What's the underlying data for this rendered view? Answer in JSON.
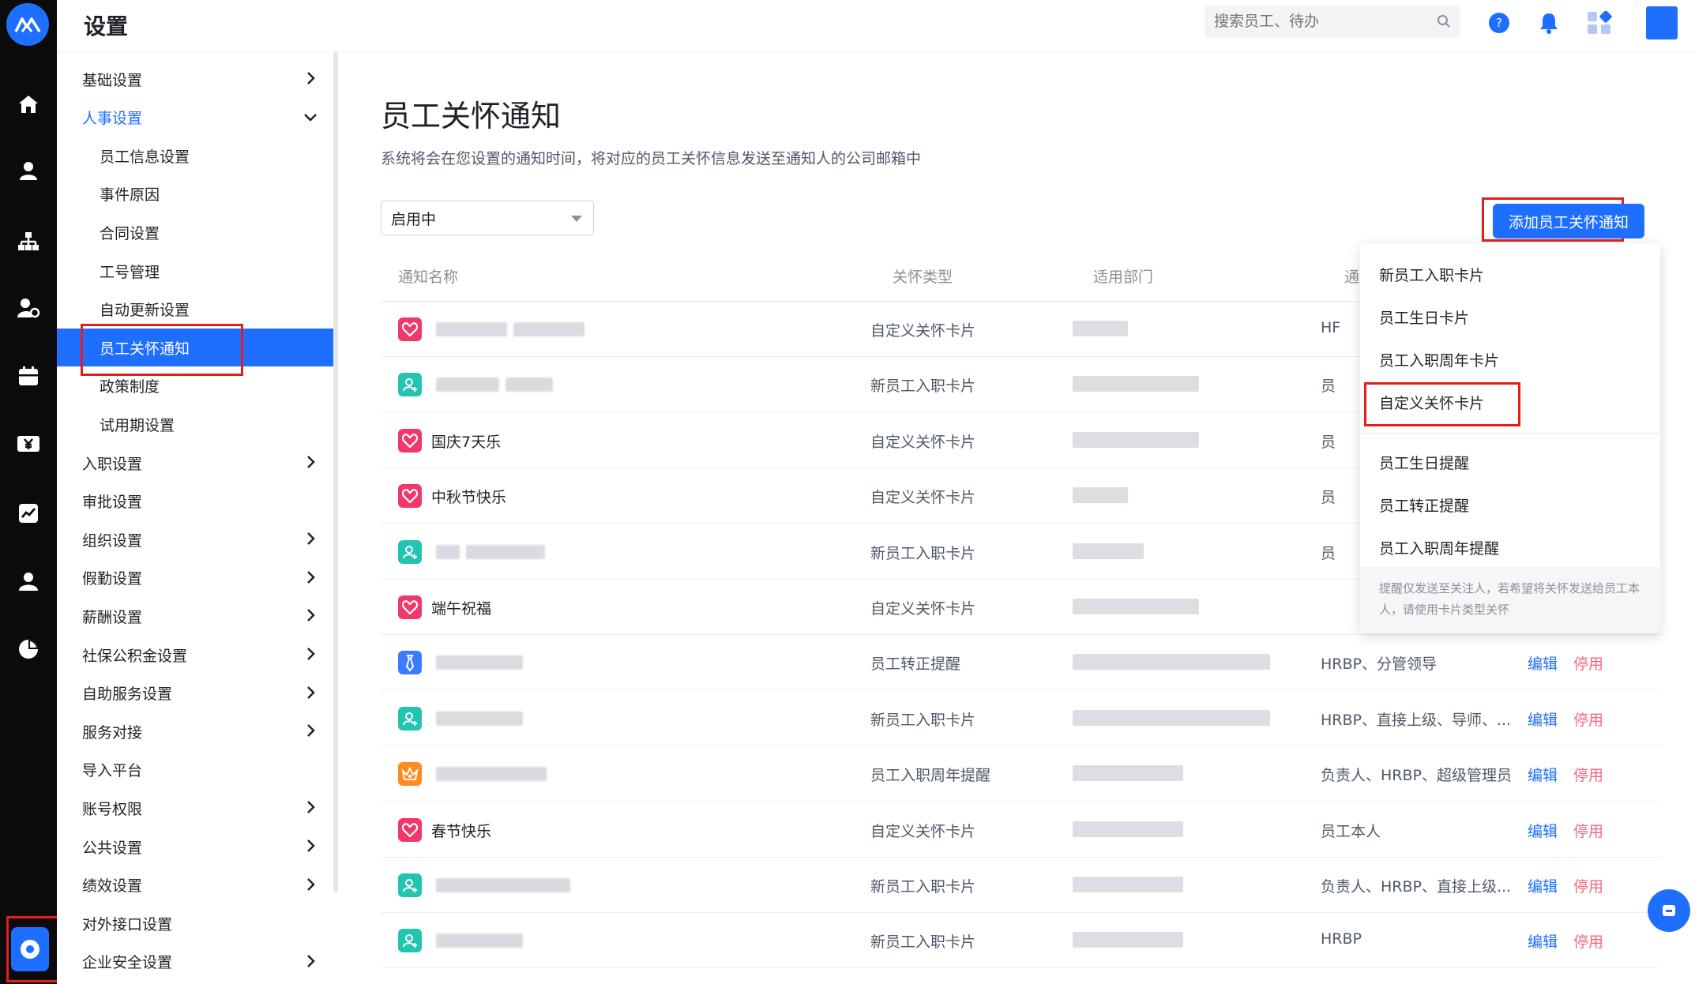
{
  "header": {
    "title": "设置",
    "search_placeholder": "搜索员工、待办"
  },
  "rail": {
    "icons": [
      "home-icon",
      "person-icon",
      "org-chart-icon",
      "user-settings-icon",
      "calendar-icon",
      "payroll-icon",
      "chart-icon",
      "profile-icon",
      "pie-chart-icon",
      "settings-icon"
    ]
  },
  "menu": {
    "items": [
      {
        "label": "基础设置",
        "level": 1,
        "chevron": "right"
      },
      {
        "label": "人事设置",
        "level": 1,
        "chevron": "down",
        "open": true
      },
      {
        "label": "员工信息设置",
        "level": 2
      },
      {
        "label": "事件原因",
        "level": 2
      },
      {
        "label": "合同设置",
        "level": 2
      },
      {
        "label": "工号管理",
        "level": 2
      },
      {
        "label": "自动更新设置",
        "level": 2
      },
      {
        "label": "员工关怀通知",
        "level": 2,
        "selected": true
      },
      {
        "label": "政策制度",
        "level": 2
      },
      {
        "label": "试用期设置",
        "level": 2
      },
      {
        "label": "入职设置",
        "level": 1,
        "chevron": "right"
      },
      {
        "label": "审批设置",
        "level": 1
      },
      {
        "label": "组织设置",
        "level": 1,
        "chevron": "right"
      },
      {
        "label": "假勤设置",
        "level": 1,
        "chevron": "right"
      },
      {
        "label": "薪酬设置",
        "level": 1,
        "chevron": "right"
      },
      {
        "label": "社保公积金设置",
        "level": 1,
        "chevron": "right"
      },
      {
        "label": "自助服务设置",
        "level": 1,
        "chevron": "right"
      },
      {
        "label": "服务对接",
        "level": 1,
        "chevron": "right"
      },
      {
        "label": "导入平台",
        "level": 1
      },
      {
        "label": "账号权限",
        "level": 1,
        "chevron": "right"
      },
      {
        "label": "公共设置",
        "level": 1,
        "chevron": "right"
      },
      {
        "label": "绩效设置",
        "level": 1,
        "chevron": "right"
      },
      {
        "label": "对外接口设置",
        "level": 1
      },
      {
        "label": "企业安全设置",
        "level": 1,
        "chevron": "right"
      }
    ]
  },
  "main": {
    "title": "员工关怀通知",
    "description": "系统将会在您设置的通知时间，将对应的员工关怀信息发送至通知人的公司邮箱中",
    "status_filter": "启用中",
    "add_button": "添加员工关怀通知",
    "columns": [
      "通知名称",
      "关怀类型",
      "适用部门",
      "通"
    ],
    "rows": [
      {
        "name": "",
        "type": "自定义关怀卡片",
        "notify": "HF",
        "icon": "heart",
        "actions": false
      },
      {
        "name": "",
        "type": "新员工入职卡片",
        "notify": "员",
        "icon": "user",
        "actions": false
      },
      {
        "name": "国庆7天乐",
        "type": "自定义关怀卡片",
        "notify": "员",
        "icon": "heart",
        "actions": false
      },
      {
        "name": "中秋节快乐",
        "type": "自定义关怀卡片",
        "notify": "员",
        "icon": "heart",
        "actions": false
      },
      {
        "name": "",
        "type": "新员工入职卡片",
        "notify": "员",
        "icon": "user",
        "actions": false
      },
      {
        "name": "端午祝福",
        "type": "自定义关怀卡片",
        "notify": "",
        "icon": "heart",
        "actions": false
      },
      {
        "name": "",
        "type": "员工转正提醒",
        "notify": "HRBP、分管领导",
        "icon": "tie",
        "actions": true
      },
      {
        "name": "",
        "type": "新员工入职卡片",
        "notify": "HRBP、直接上级、导师、...",
        "icon": "user",
        "actions": true
      },
      {
        "name": "",
        "type": "员工入职周年提醒",
        "notify": "负责人、HRBP、超级管理员",
        "icon": "crown",
        "actions": true
      },
      {
        "name": "春节快乐",
        "type": "自定义关怀卡片",
        "notify": "员工本人",
        "icon": "heart",
        "actions": true
      },
      {
        "name": "",
        "type": "新员工入职卡片",
        "notify": "负责人、HRBP、直接上级...",
        "icon": "user",
        "actions": true
      },
      {
        "name": "",
        "type": "新员工入职卡片",
        "notify": "HRBP",
        "icon": "user",
        "actions": true
      }
    ],
    "edit_label": "编辑",
    "disable_label": "停用"
  },
  "dropdown": {
    "card_items": [
      "新员工入职卡片",
      "员工生日卡片",
      "员工入职周年卡片",
      "自定义关怀卡片"
    ],
    "reminder_items": [
      "员工生日提醒",
      "员工转正提醒",
      "员工入职周年提醒"
    ],
    "note": "提醒仅发送至关注人，若希望将关怀发送给员工本人，请使用卡片类型关怀"
  },
  "colors": {
    "accent": "#1e6fff",
    "highlight_box": "#e41d1d",
    "heart_icon": "#f0386b",
    "user_icon": "#23c4b0",
    "tie_icon": "#3c7bff",
    "crown_icon": "#ff8a1f",
    "disable_text": "#f5677e"
  }
}
